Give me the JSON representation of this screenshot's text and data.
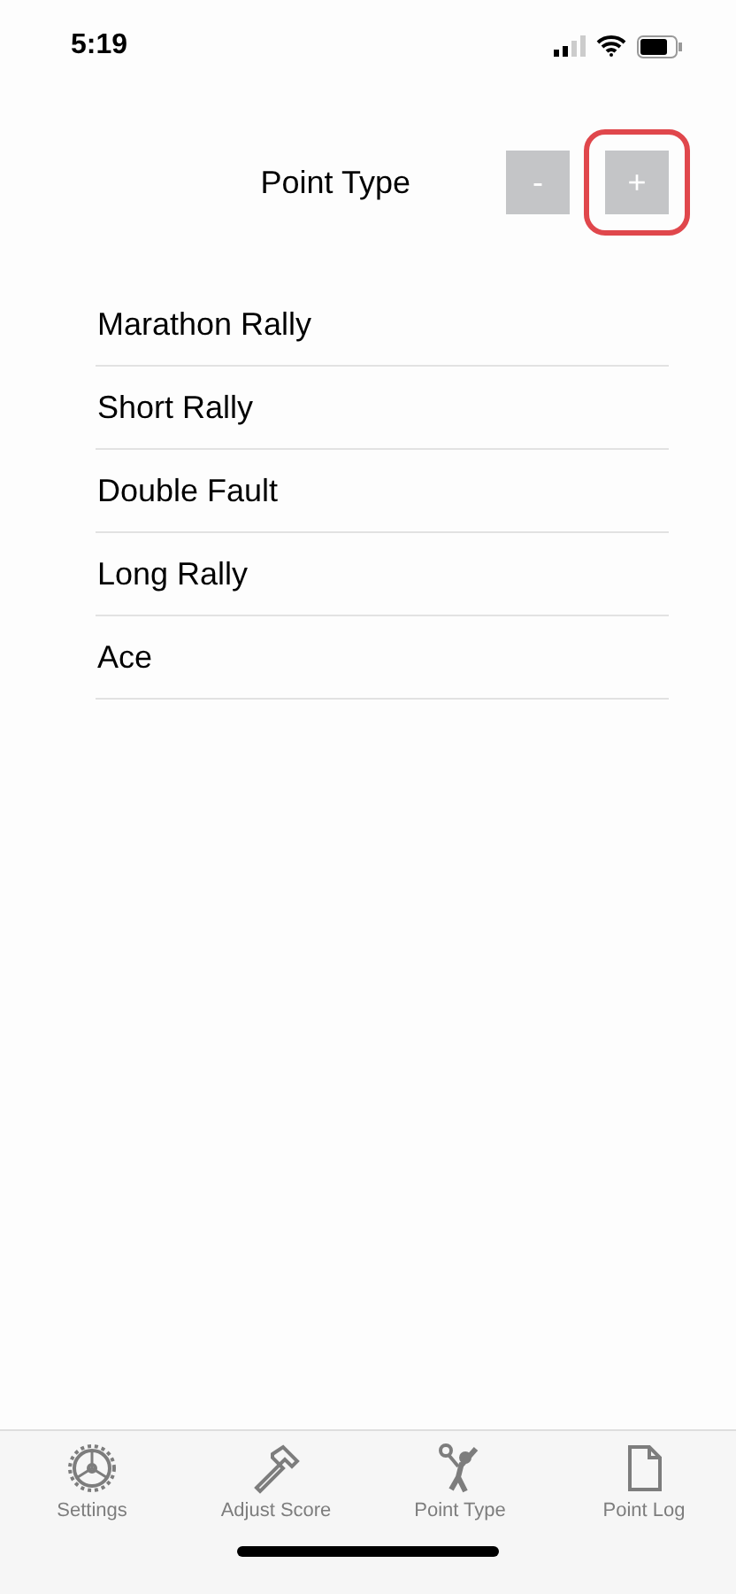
{
  "status_bar": {
    "time": "5:19"
  },
  "header": {
    "title": "Point Type",
    "buttons": [
      {
        "label": "-",
        "highlighted": false
      },
      {
        "label": "+",
        "highlighted": true
      }
    ]
  },
  "point_types": [
    "Marathon Rally",
    "Short Rally",
    "Double Fault",
    "Long Rally",
    "Ace"
  ],
  "tab_bar": [
    {
      "kind": "gear",
      "label": "Settings",
      "selected": false
    },
    {
      "kind": "hammer",
      "label": "Adjust Score",
      "selected": false
    },
    {
      "kind": "player",
      "label": "Point Type",
      "selected": false
    },
    {
      "kind": "document",
      "label": "Point Log",
      "selected": false
    }
  ]
}
